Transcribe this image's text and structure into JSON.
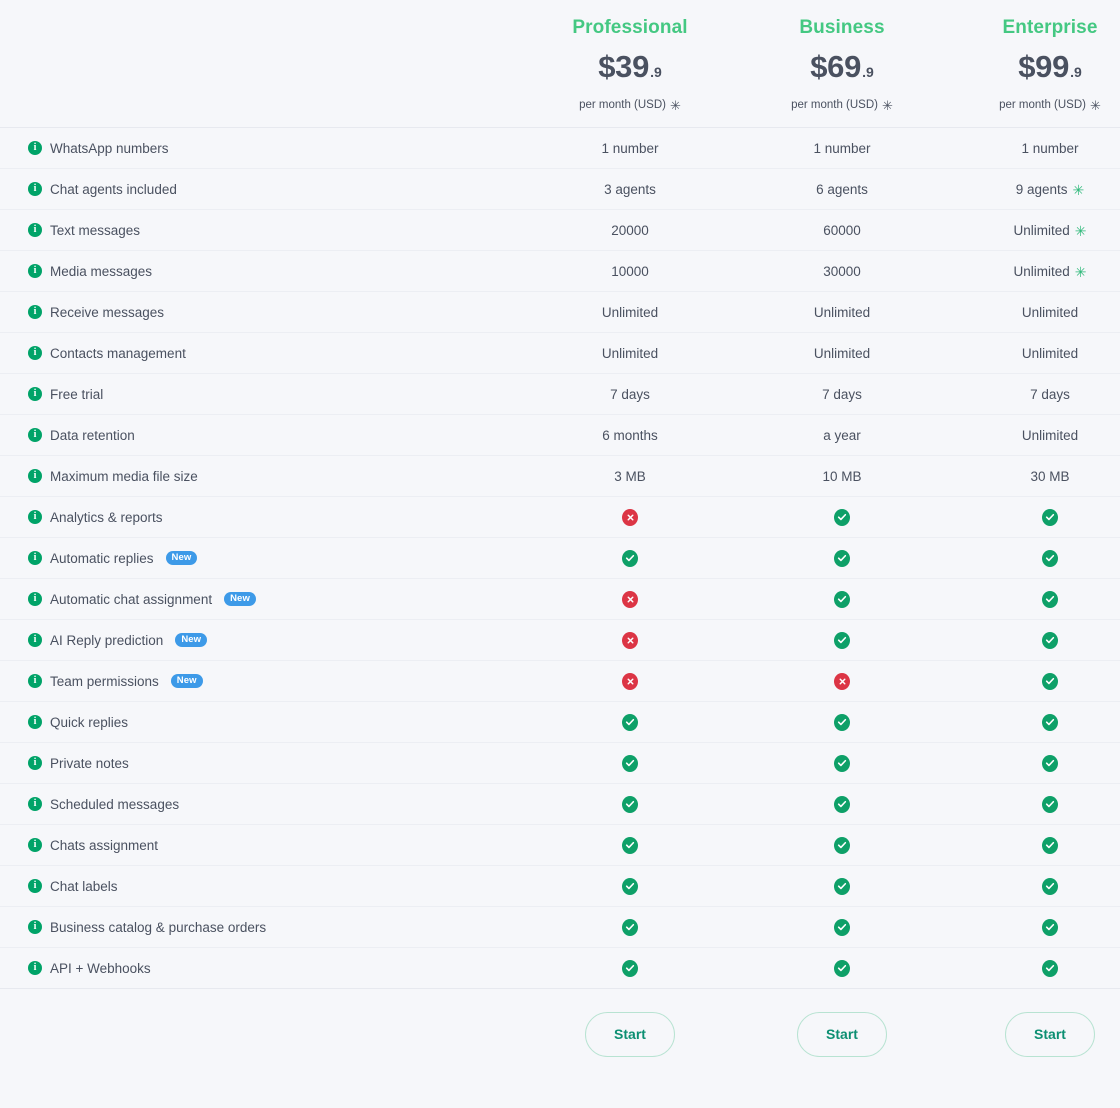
{
  "plans": [
    {
      "name": "Professional",
      "price_amount": "$39",
      "price_cents": ".9",
      "period": "per month (USD)",
      "period_asterisk": "✳",
      "cta": "Start"
    },
    {
      "name": "Business",
      "price_amount": "$69",
      "price_cents": ".9",
      "period": "per month (USD)",
      "period_asterisk": "✳",
      "cta": "Start"
    },
    {
      "name": "Enterprise",
      "price_amount": "$99",
      "price_cents": ".9",
      "period": "per month (USD)",
      "period_asterisk": "✳",
      "cta": "Start"
    }
  ],
  "info_icon_glyph": "i",
  "new_badge_label": "New",
  "asterisk_glyph": "✳",
  "colors": {
    "plan_name_green": "#44c882",
    "info_icon_green": "#00a368",
    "check_green": "#0ea068",
    "cross_red": "#dc3545",
    "new_badge_blue": "#3d9ae8",
    "cta_text": "#0c8f72",
    "cta_border": "#b8e3d2",
    "background": "#f6f7fa",
    "text": "#4a5160",
    "divider": "#eceef3"
  },
  "features": [
    {
      "label": "WhatsApp numbers",
      "badge": null,
      "values": [
        {
          "type": "text",
          "text": "1 number",
          "asterisk": false
        },
        {
          "type": "text",
          "text": "1 number",
          "asterisk": false
        },
        {
          "type": "text",
          "text": "1 number",
          "asterisk": false
        }
      ]
    },
    {
      "label": "Chat agents included",
      "badge": null,
      "values": [
        {
          "type": "text",
          "text": "3 agents",
          "asterisk": false
        },
        {
          "type": "text",
          "text": "6 agents",
          "asterisk": false
        },
        {
          "type": "text",
          "text": "9 agents",
          "asterisk": true
        }
      ]
    },
    {
      "label": "Text messages",
      "badge": null,
      "values": [
        {
          "type": "text",
          "text": "20000",
          "asterisk": false
        },
        {
          "type": "text",
          "text": "60000",
          "asterisk": false
        },
        {
          "type": "text",
          "text": "Unlimited",
          "asterisk": true
        }
      ]
    },
    {
      "label": "Media messages",
      "badge": null,
      "values": [
        {
          "type": "text",
          "text": "10000",
          "asterisk": false
        },
        {
          "type": "text",
          "text": "30000",
          "asterisk": false
        },
        {
          "type": "text",
          "text": "Unlimited",
          "asterisk": true
        }
      ]
    },
    {
      "label": "Receive messages",
      "badge": null,
      "values": [
        {
          "type": "text",
          "text": "Unlimited",
          "asterisk": false
        },
        {
          "type": "text",
          "text": "Unlimited",
          "asterisk": false
        },
        {
          "type": "text",
          "text": "Unlimited",
          "asterisk": false
        }
      ]
    },
    {
      "label": "Contacts management",
      "badge": null,
      "values": [
        {
          "type": "text",
          "text": "Unlimited",
          "asterisk": false
        },
        {
          "type": "text",
          "text": "Unlimited",
          "asterisk": false
        },
        {
          "type": "text",
          "text": "Unlimited",
          "asterisk": false
        }
      ]
    },
    {
      "label": "Free trial",
      "badge": null,
      "values": [
        {
          "type": "text",
          "text": "7 days",
          "asterisk": false
        },
        {
          "type": "text",
          "text": "7 days",
          "asterisk": false
        },
        {
          "type": "text",
          "text": "7 days",
          "asterisk": false
        }
      ]
    },
    {
      "label": "Data retention",
      "badge": null,
      "values": [
        {
          "type": "text",
          "text": "6 months",
          "asterisk": false
        },
        {
          "type": "text",
          "text": "a year",
          "asterisk": false
        },
        {
          "type": "text",
          "text": "Unlimited",
          "asterisk": false
        }
      ]
    },
    {
      "label": "Maximum media file size",
      "badge": null,
      "values": [
        {
          "type": "text",
          "text": "3 MB",
          "asterisk": false
        },
        {
          "type": "text",
          "text": "10 MB",
          "asterisk": false
        },
        {
          "type": "text",
          "text": "30 MB",
          "asterisk": false
        }
      ]
    },
    {
      "label": "Analytics & reports",
      "badge": null,
      "values": [
        {
          "type": "no"
        },
        {
          "type": "yes"
        },
        {
          "type": "yes"
        }
      ]
    },
    {
      "label": "Automatic replies",
      "badge": "New",
      "values": [
        {
          "type": "yes"
        },
        {
          "type": "yes"
        },
        {
          "type": "yes"
        }
      ]
    },
    {
      "label": "Automatic chat assignment",
      "badge": "New",
      "values": [
        {
          "type": "no"
        },
        {
          "type": "yes"
        },
        {
          "type": "yes"
        }
      ]
    },
    {
      "label": "AI Reply prediction",
      "badge": "New",
      "values": [
        {
          "type": "no"
        },
        {
          "type": "yes"
        },
        {
          "type": "yes"
        }
      ]
    },
    {
      "label": "Team permissions",
      "badge": "New",
      "values": [
        {
          "type": "no"
        },
        {
          "type": "no"
        },
        {
          "type": "yes"
        }
      ]
    },
    {
      "label": "Quick replies",
      "badge": null,
      "values": [
        {
          "type": "yes"
        },
        {
          "type": "yes"
        },
        {
          "type": "yes"
        }
      ]
    },
    {
      "label": "Private notes",
      "badge": null,
      "values": [
        {
          "type": "yes"
        },
        {
          "type": "yes"
        },
        {
          "type": "yes"
        }
      ]
    },
    {
      "label": "Scheduled messages",
      "badge": null,
      "values": [
        {
          "type": "yes"
        },
        {
          "type": "yes"
        },
        {
          "type": "yes"
        }
      ]
    },
    {
      "label": "Chats assignment",
      "badge": null,
      "values": [
        {
          "type": "yes"
        },
        {
          "type": "yes"
        },
        {
          "type": "yes"
        }
      ]
    },
    {
      "label": "Chat labels",
      "badge": null,
      "values": [
        {
          "type": "yes"
        },
        {
          "type": "yes"
        },
        {
          "type": "yes"
        }
      ]
    },
    {
      "label": "Business catalog & purchase orders",
      "badge": null,
      "values": [
        {
          "type": "yes"
        },
        {
          "type": "yes"
        },
        {
          "type": "yes"
        }
      ]
    },
    {
      "label": "API + Webhooks",
      "badge": null,
      "values": [
        {
          "type": "yes"
        },
        {
          "type": "yes"
        },
        {
          "type": "yes"
        }
      ]
    }
  ]
}
